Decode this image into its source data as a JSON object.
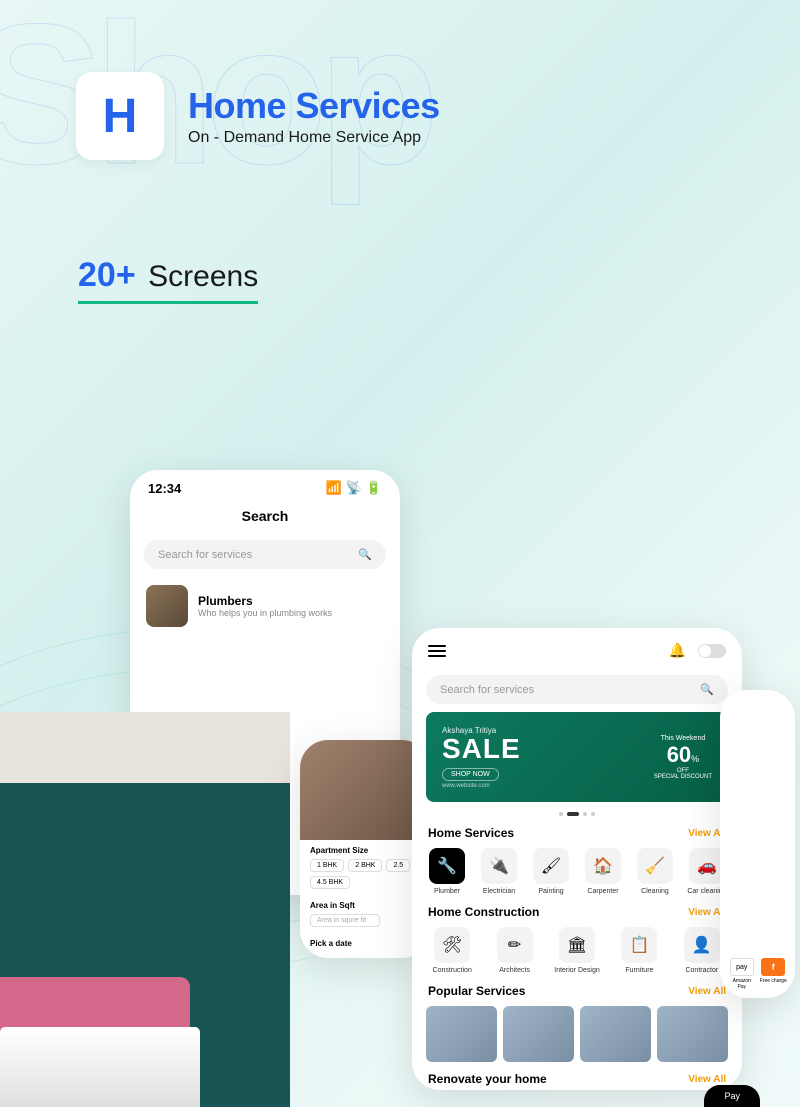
{
  "bg_text": "Shop",
  "logo_letter": "H",
  "title": "Home Services",
  "subtitle": "On - Demand Home Service App",
  "screens_num": "20+",
  "screens_label": "Screens",
  "phone1": {
    "time": "12:34",
    "title": "Search",
    "search_placeholder": "Search for services",
    "item1_title": "Plumbers",
    "item1_sub": "Who helps you in plumbing works"
  },
  "phone2": {
    "apt_title": "Apartment Size",
    "chip1": "1 BHK",
    "chip2": "2 BHK",
    "chip3": "2.5",
    "chip4": "4.5 BHK",
    "area_title": "Area in Sqft",
    "area_placeholder": "Area in squre fit",
    "date_title": "Pick a date"
  },
  "phone3": {
    "search_placeholder": "Search for services",
    "banner_top": "Akshaya Tritiya",
    "banner_sale": "SALE",
    "banner_shop": "SHOP NOW",
    "banner_url": "www.website.com",
    "banner_tw": "This Weekend",
    "banner_pct": "60",
    "banner_off": "OFF",
    "banner_disc": "SPECIAL DISCOUNT",
    "sec1": "Home Services",
    "sec2": "Home Construction",
    "sec3": "Popular Services",
    "sec4": "Renovate your home",
    "view_all": "View All",
    "cats1": [
      "Plumber",
      "Electrician",
      "Painting",
      "Carpenter",
      "Cleaning",
      "Car cleaning"
    ],
    "cats1_icons": [
      "🔧",
      "🔌",
      "🖌",
      "🏠",
      "🧹",
      "🚗"
    ],
    "cats2": [
      "Construction",
      "Architects",
      "Interior Design",
      "Furniture",
      "Contractor"
    ],
    "cats2_icons": [
      "🛠",
      "✏",
      "🏛",
      "📋",
      "👤"
    ]
  },
  "phone4": {
    "pay1": "pay",
    "pay2": "f",
    "lbl1": "Amazon Pay",
    "lbl2": "Free charge"
  },
  "pay_button": "Pay"
}
